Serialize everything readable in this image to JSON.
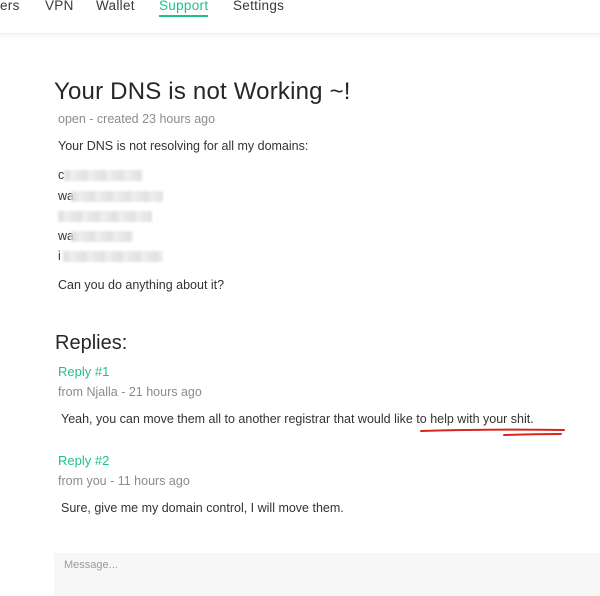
{
  "nav": {
    "items": [
      {
        "label": "ers"
      },
      {
        "label": "VPN"
      },
      {
        "label": "Wallet"
      },
      {
        "label": "Support"
      },
      {
        "label": "Settings"
      }
    ],
    "active": "Support",
    "accent_color": "#1fbf8f"
  },
  "ticket": {
    "title": "Your DNS is not Working ~!",
    "meta": "open - created 23 hours ago",
    "body_intro": "Your DNS is not resolving for all my domains:",
    "domains": [
      {
        "visible_prefix": "c"
      },
      {
        "visible_prefix": "wa"
      },
      {
        "visible_prefix": ""
      },
      {
        "visible_prefix": "wa"
      },
      {
        "visible_prefix": "i"
      }
    ],
    "question": "Can you do anything about it?"
  },
  "replies": {
    "heading": "Replies:",
    "items": [
      {
        "label": "Reply #1",
        "meta": "from Njalla - 21 hours ago",
        "text": "Yeah, you can move them all to another registrar that would like to help with your shit."
      },
      {
        "label": "Reply #2",
        "meta": "from you - 11 hours ago",
        "text": "Sure, give me my domain control, I will move them."
      }
    ]
  },
  "message": {
    "placeholder": "Message...",
    "value": ""
  },
  "annotation_color": "#d8261c"
}
